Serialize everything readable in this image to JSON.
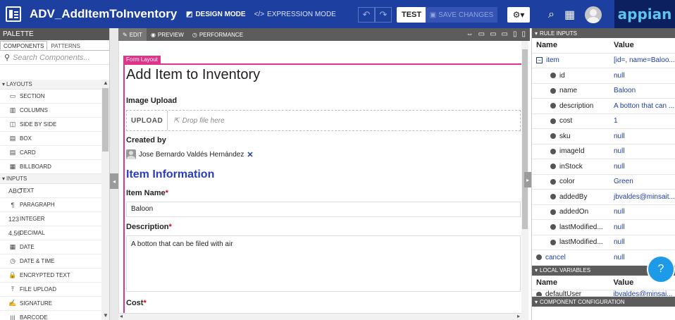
{
  "header": {
    "app_title": "ADV_AddItemToInventory",
    "design_mode": "DESIGN MODE",
    "expression_mode": "EXPRESSION MODE",
    "test": "TEST",
    "save": "SAVE CHANGES",
    "brand": "appian",
    "colors": {
      "bar": "#1d3fa0",
      "brand_bg": "#0c1f5e",
      "brand_text": "#5fc3ef"
    }
  },
  "palette": {
    "title": "PALETTE",
    "tabs": [
      "COMPONENTS",
      "PATTERNS"
    ],
    "search_placeholder": "Search Components...",
    "sections": [
      {
        "label": "LAYOUTS",
        "items": [
          {
            "icon": "▭",
            "label": "SECTION"
          },
          {
            "icon": "▥",
            "label": "COLUMNS"
          },
          {
            "icon": "◫",
            "label": "SIDE BY SIDE"
          },
          {
            "icon": "▤",
            "label": "BOX"
          },
          {
            "icon": "▤",
            "label": "CARD"
          },
          {
            "icon": "▦",
            "label": "BILLBOARD"
          }
        ]
      },
      {
        "label": "INPUTS",
        "items": [
          {
            "icon": "Abc",
            "label": "TEXT"
          },
          {
            "icon": "¶",
            "label": "PARAGRAPH"
          },
          {
            "icon": "123",
            "label": "INTEGER"
          },
          {
            "icon": "4.56",
            "label": "DECIMAL"
          },
          {
            "icon": "▦",
            "label": "DATE"
          },
          {
            "icon": "◷",
            "label": "DATE & TIME"
          },
          {
            "icon": "🔒",
            "label": "ENCRYPTED TEXT"
          },
          {
            "icon": "⤒",
            "label": "FILE UPLOAD"
          },
          {
            "icon": "✍",
            "label": "SIGNATURE"
          },
          {
            "icon": "|||",
            "label": "BARCODE"
          }
        ]
      }
    ]
  },
  "editor": {
    "tabs": [
      "EDIT",
      "PREVIEW",
      "PERFORMANCE"
    ],
    "form": {
      "tag": "Form Layout",
      "title": "Add Item to Inventory",
      "image_upload_label": "Image Upload",
      "upload_button": "UPLOAD",
      "drop_text": "Drop file here",
      "created_by_label": "Created by",
      "created_by_user": "Jose Bernardo Valdés Hernández",
      "section_title": "Item Information",
      "item_name_label": "Item Name",
      "item_name_value": "Baloon",
      "description_label": "Description",
      "description_value": "A botton that can be  filed with air",
      "cost_label": "Cost",
      "required_mark": "*"
    }
  },
  "rule_inputs": {
    "title": "RULE INPUTS",
    "col_name": "Name",
    "col_value": "Value",
    "rows": [
      {
        "name": "item",
        "value": "[id=, name=Baloo...",
        "type": "expander"
      },
      {
        "name": "id",
        "value": "null",
        "type": "child"
      },
      {
        "name": "name",
        "value": "Baloon",
        "type": "child"
      },
      {
        "name": "description",
        "value": "A botton that can ...",
        "type": "child"
      },
      {
        "name": "cost",
        "value": "1",
        "type": "child"
      },
      {
        "name": "sku",
        "value": "null",
        "type": "child"
      },
      {
        "name": "imageId",
        "value": "null",
        "type": "child"
      },
      {
        "name": "inStock",
        "value": "null",
        "type": "child"
      },
      {
        "name": "color",
        "value": "Green",
        "type": "child"
      },
      {
        "name": "addedBy",
        "value": "jbvaldes@minsait...",
        "type": "child"
      },
      {
        "name": "addedOn",
        "value": "null",
        "type": "child"
      },
      {
        "name": "lastModified...",
        "value": "null",
        "type": "child"
      },
      {
        "name": "lastModified...",
        "value": "null",
        "type": "child"
      },
      {
        "name": "cancel",
        "value": "null",
        "type": "top"
      }
    ]
  },
  "local_variables": {
    "title": "LOCAL VARIABLES",
    "col_name": "Name",
    "col_value": "Value",
    "rows": [
      {
        "name": "defaultUser",
        "value": "jbvaldes@minsai..."
      }
    ]
  },
  "component_configuration": {
    "title": "COMPONENT CONFIGURATION"
  }
}
